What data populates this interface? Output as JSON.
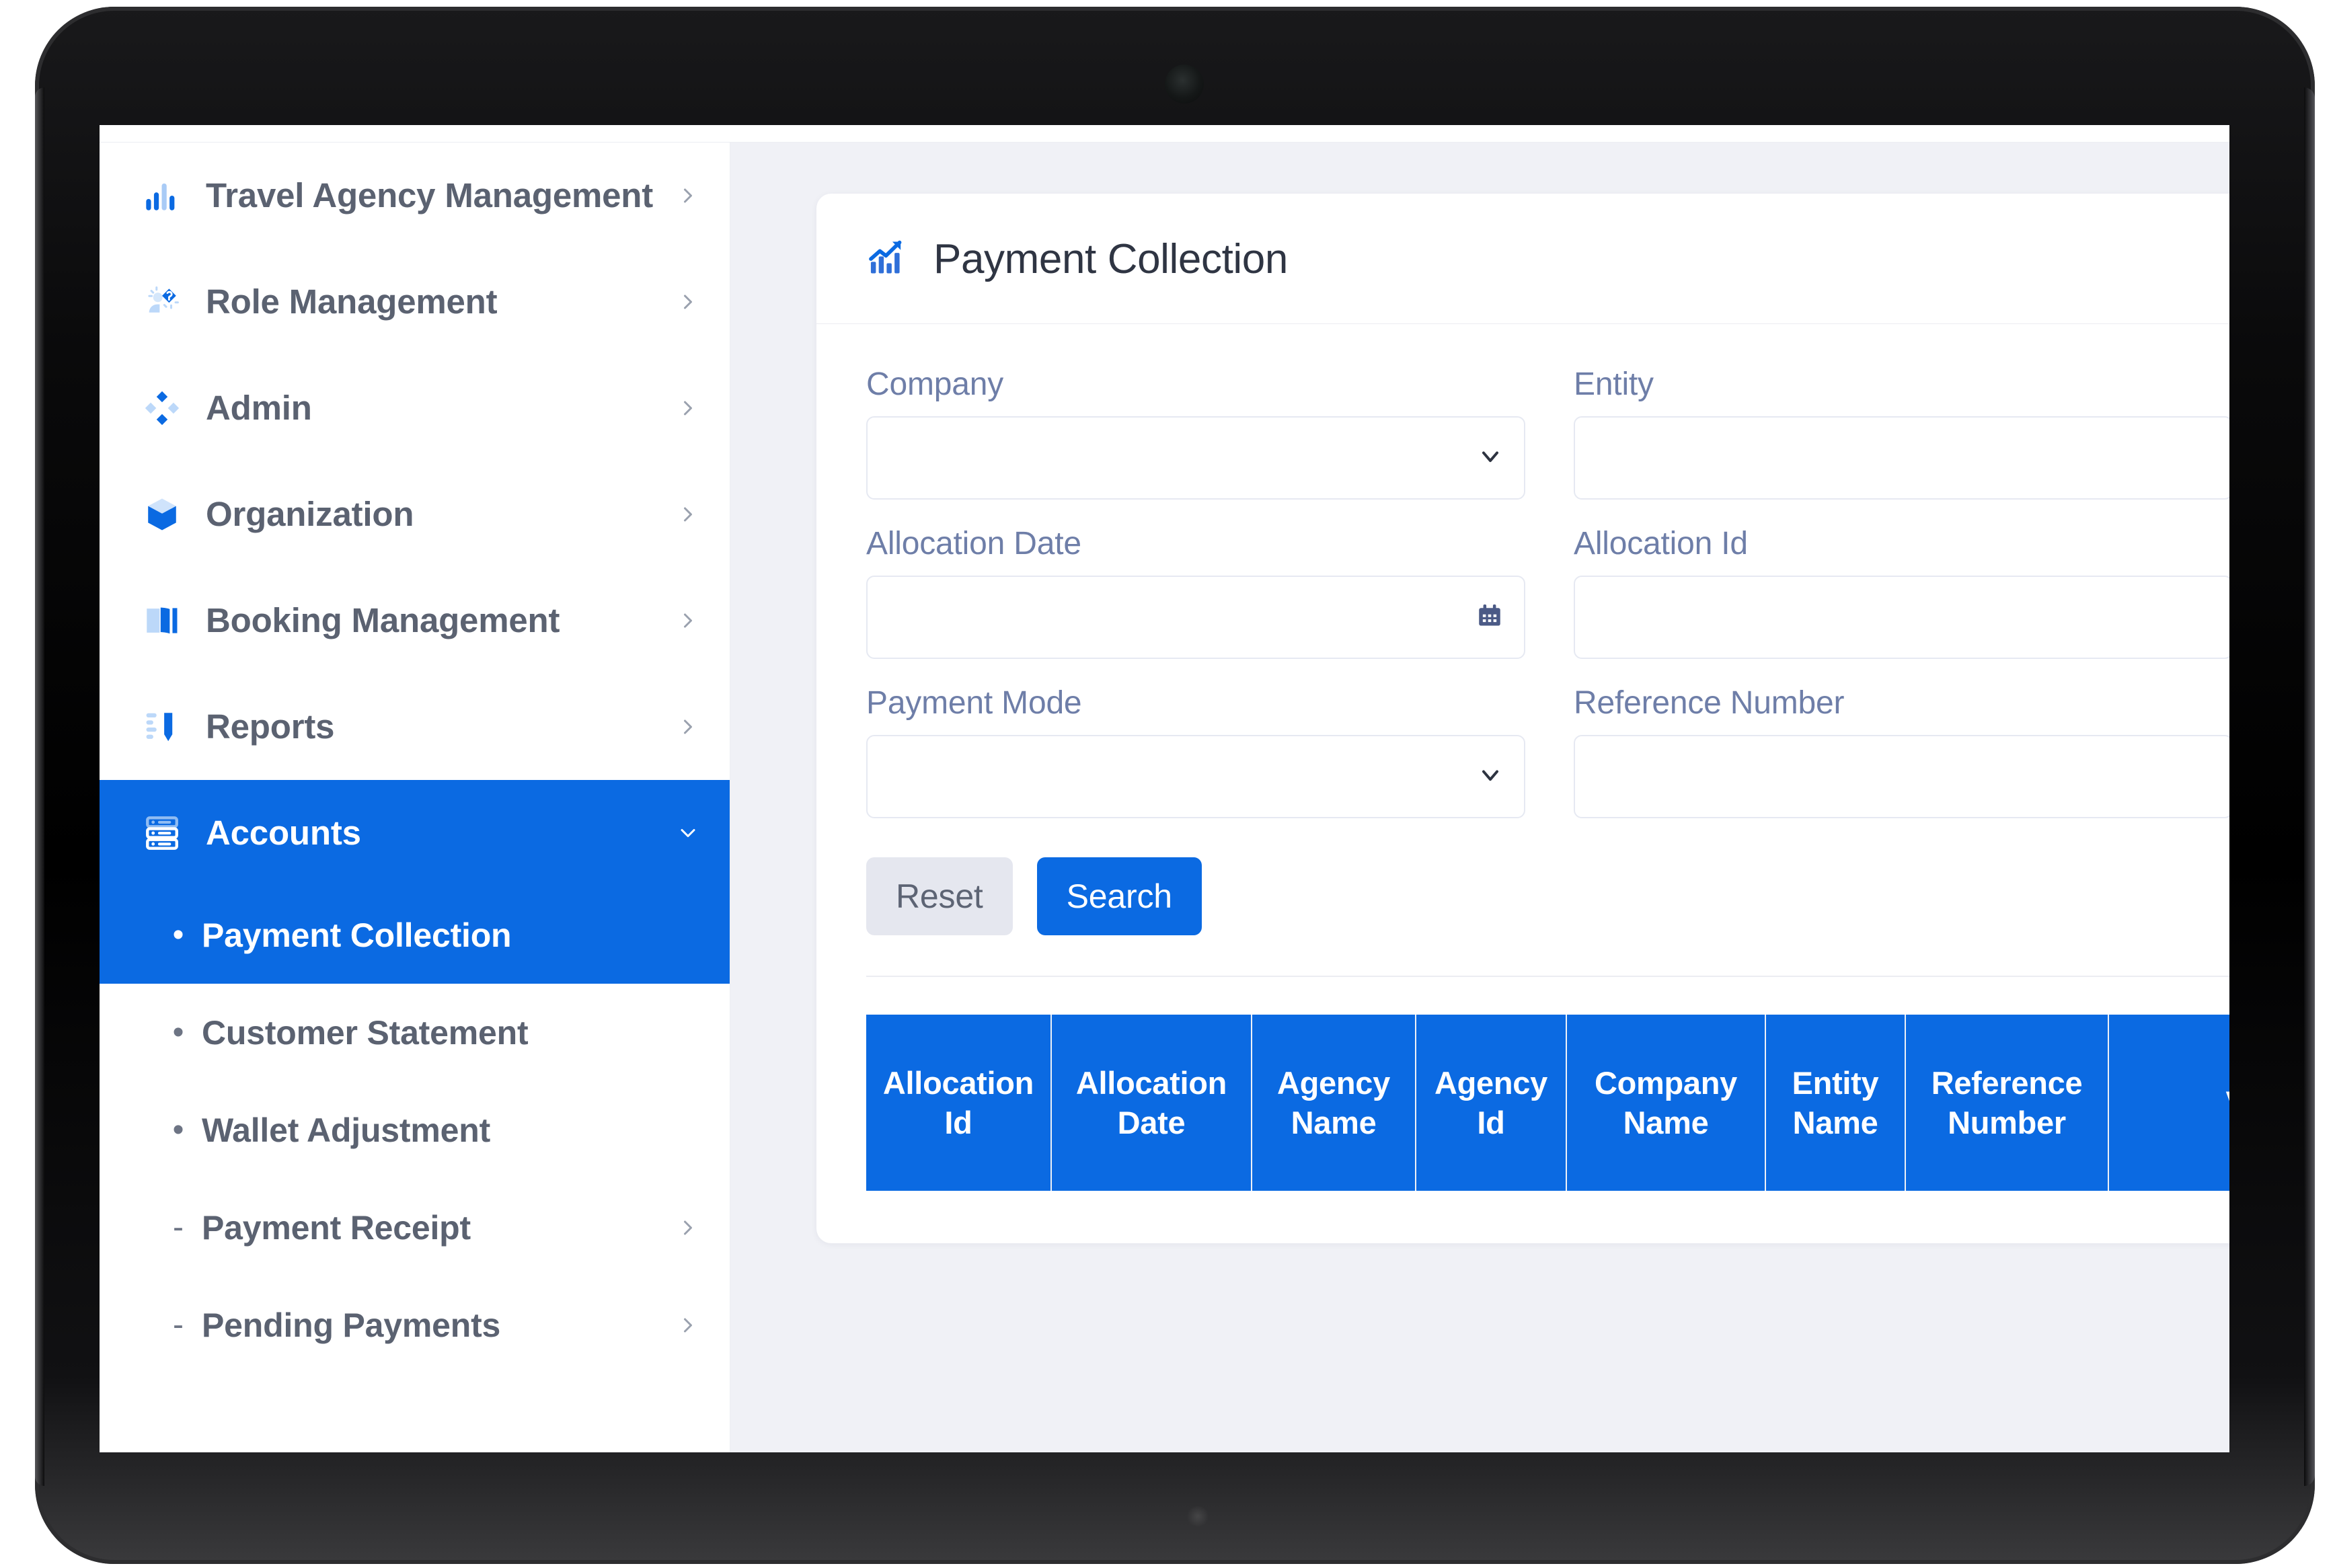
{
  "sidebar": {
    "items": [
      {
        "label": "Travel Agency Management",
        "icon": "bar-chart-icon",
        "chevron": "chevron-right",
        "active": false
      },
      {
        "label": "Role Management",
        "icon": "user-role-icon",
        "chevron": "chevron-right",
        "active": false
      },
      {
        "label": "Admin",
        "icon": "diamond-grid-icon",
        "chevron": "chevron-right",
        "active": false
      },
      {
        "label": "Organization",
        "icon": "cube-icon",
        "chevron": "chevron-right",
        "active": false
      },
      {
        "label": "Booking Management",
        "icon": "book-icon",
        "chevron": "chevron-right",
        "active": false
      },
      {
        "label": "Reports",
        "icon": "report-ruler-icon",
        "chevron": "chevron-right",
        "active": false
      },
      {
        "label": "Accounts",
        "icon": "server-rack-icon",
        "chevron": "chevron-down",
        "active": true
      }
    ],
    "subitems": [
      {
        "label": "Payment Collection",
        "bullet": "•",
        "chevron": false,
        "active": true
      },
      {
        "label": "Customer Statement",
        "bullet": "•",
        "chevron": false,
        "active": false
      },
      {
        "label": "Wallet Adjustment",
        "bullet": "•",
        "chevron": false,
        "active": false
      },
      {
        "label": "Payment Receipt",
        "bullet": "-",
        "chevron": true,
        "active": false
      },
      {
        "label": "Pending Payments",
        "bullet": "-",
        "chevron": true,
        "active": false
      }
    ]
  },
  "page": {
    "title": "Payment Collection",
    "title_icon": "chart-trend-up-icon"
  },
  "form": {
    "fields": [
      {
        "label": "Company",
        "type": "select",
        "value": "",
        "placeholder": ""
      },
      {
        "label": "Entity",
        "type": "text",
        "value": "",
        "placeholder": ""
      },
      {
        "label": "Allocation Date",
        "type": "date",
        "value": "",
        "placeholder": ""
      },
      {
        "label": "Allocation Id",
        "type": "text",
        "value": "",
        "placeholder": ""
      },
      {
        "label": "Payment Mode",
        "type": "select",
        "value": "",
        "placeholder": ""
      },
      {
        "label": "Reference Number",
        "type": "text",
        "value": "",
        "placeholder": ""
      }
    ],
    "reset_label": "Reset",
    "search_label": "Search"
  },
  "table": {
    "columns": [
      "Allocation Id",
      "Allocation Date",
      "Agency Name",
      "Agency Id",
      "Company Name",
      "Entity Name",
      "Reference Number",
      "View"
    ],
    "rows": []
  },
  "colors": {
    "accent": "#0b6ae2",
    "page_bg": "#f0f1f6",
    "card_bg": "#ffffff",
    "label_text": "#6e7ea8",
    "nav_text": "#5b6271",
    "reset_bg": "#e5e7ef"
  }
}
